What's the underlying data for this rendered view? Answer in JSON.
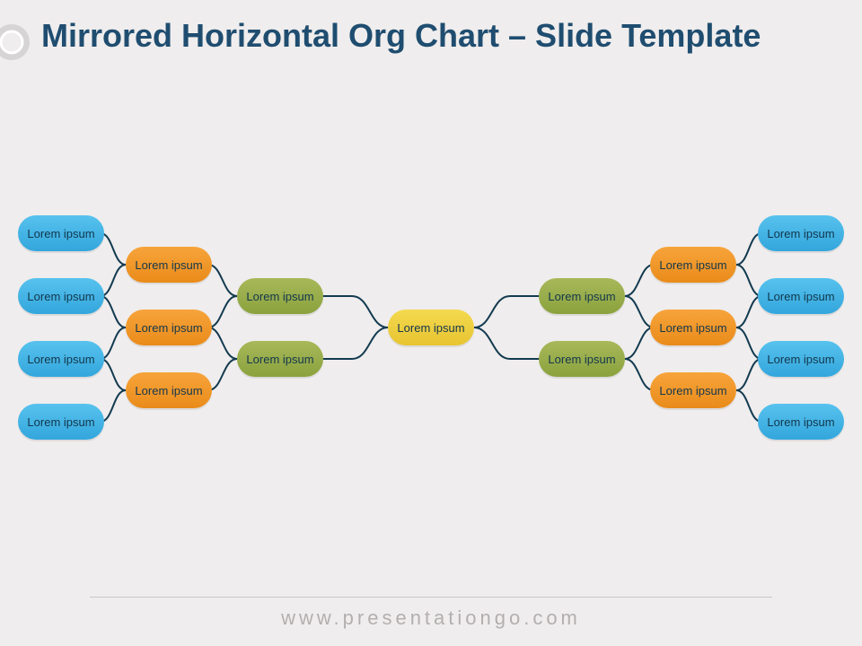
{
  "header": {
    "title": "Mirrored Horizontal Org Chart – Slide Template"
  },
  "chart": {
    "center": {
      "label": "Lorem ipsum"
    },
    "left": {
      "level2": [
        {
          "label": "Lorem ipsum"
        },
        {
          "label": "Lorem ipsum"
        }
      ],
      "level3": [
        {
          "label": "Lorem ipsum"
        },
        {
          "label": "Lorem ipsum"
        },
        {
          "label": "Lorem ipsum"
        }
      ],
      "level4": [
        {
          "label": "Lorem ipsum"
        },
        {
          "label": "Lorem ipsum"
        },
        {
          "label": "Lorem ipsum"
        },
        {
          "label": "Lorem ipsum"
        }
      ]
    },
    "right": {
      "level2": [
        {
          "label": "Lorem ipsum"
        },
        {
          "label": "Lorem ipsum"
        }
      ],
      "level3": [
        {
          "label": "Lorem ipsum"
        },
        {
          "label": "Lorem ipsum"
        },
        {
          "label": "Lorem ipsum"
        }
      ],
      "level4": [
        {
          "label": "Lorem ipsum"
        },
        {
          "label": "Lorem ipsum"
        },
        {
          "label": "Lorem ipsum"
        },
        {
          "label": "Lorem ipsum"
        }
      ]
    }
  },
  "footer": {
    "text": "www.presentationgo.com"
  },
  "colors": {
    "blue": "#3fb1e3",
    "orange": "#ef922a",
    "green": "#97ab48",
    "yellow": "#edcd3e",
    "title": "#1f4d70",
    "connector": "#123a50"
  }
}
